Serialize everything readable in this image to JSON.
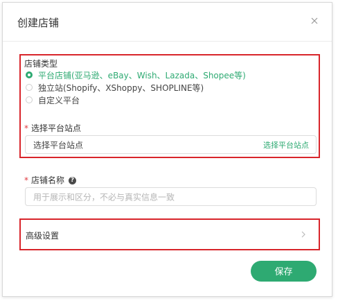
{
  "dialog": {
    "title": "创建店铺",
    "close_icon": "close-icon"
  },
  "store_type": {
    "label": "店铺类型",
    "options": [
      {
        "label": "平台店铺(亚马逊、eBay、Wish、Lazada、Shopee等)",
        "selected": true
      },
      {
        "label": "独立站(Shopify、XShoppy、SHOPLINE等)",
        "selected": false
      },
      {
        "label": "自定义平台",
        "selected": false
      }
    ]
  },
  "platform_site": {
    "required_mark": "*",
    "label": "选择平台站点",
    "value": "选择平台站点",
    "link": "选择平台站点"
  },
  "store_name": {
    "required_mark": "*",
    "label": "店铺名称",
    "help_icon": "question-icon",
    "placeholder": "用于展示和区分，不必与真实信息一致"
  },
  "advanced": {
    "label": "高级设置",
    "chevron_icon": "chevron-right-icon"
  },
  "footer": {
    "save_label": "保存"
  },
  "colors": {
    "accent": "#2eaa72",
    "highlight_border": "#d8242a",
    "required": "#e0383e"
  }
}
